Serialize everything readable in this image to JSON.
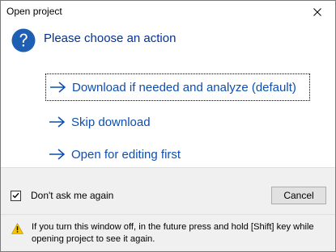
{
  "window": {
    "title": "Open project"
  },
  "heading": "Please choose an action",
  "actions": [
    {
      "label": "Download if needed and analyze (default)"
    },
    {
      "label": "Skip download"
    },
    {
      "label": "Open for editing first"
    }
  ],
  "footer": {
    "checkbox_label": "Don't ask me again",
    "checkbox_checked": true,
    "cancel_label": "Cancel",
    "warning_text": "If you turn this window off, in the future press and hold [Shift] key while opening project to see it again."
  },
  "colors": {
    "heading": "#003399",
    "link": "#0c4fb0",
    "question_icon": "#1e5fb4",
    "warning_icon": "#f5c400"
  },
  "icons": {
    "close": "close-icon",
    "question": "question-icon",
    "arrow": "arrow-right-icon",
    "check": "checkmark-icon",
    "warning": "warning-icon"
  }
}
